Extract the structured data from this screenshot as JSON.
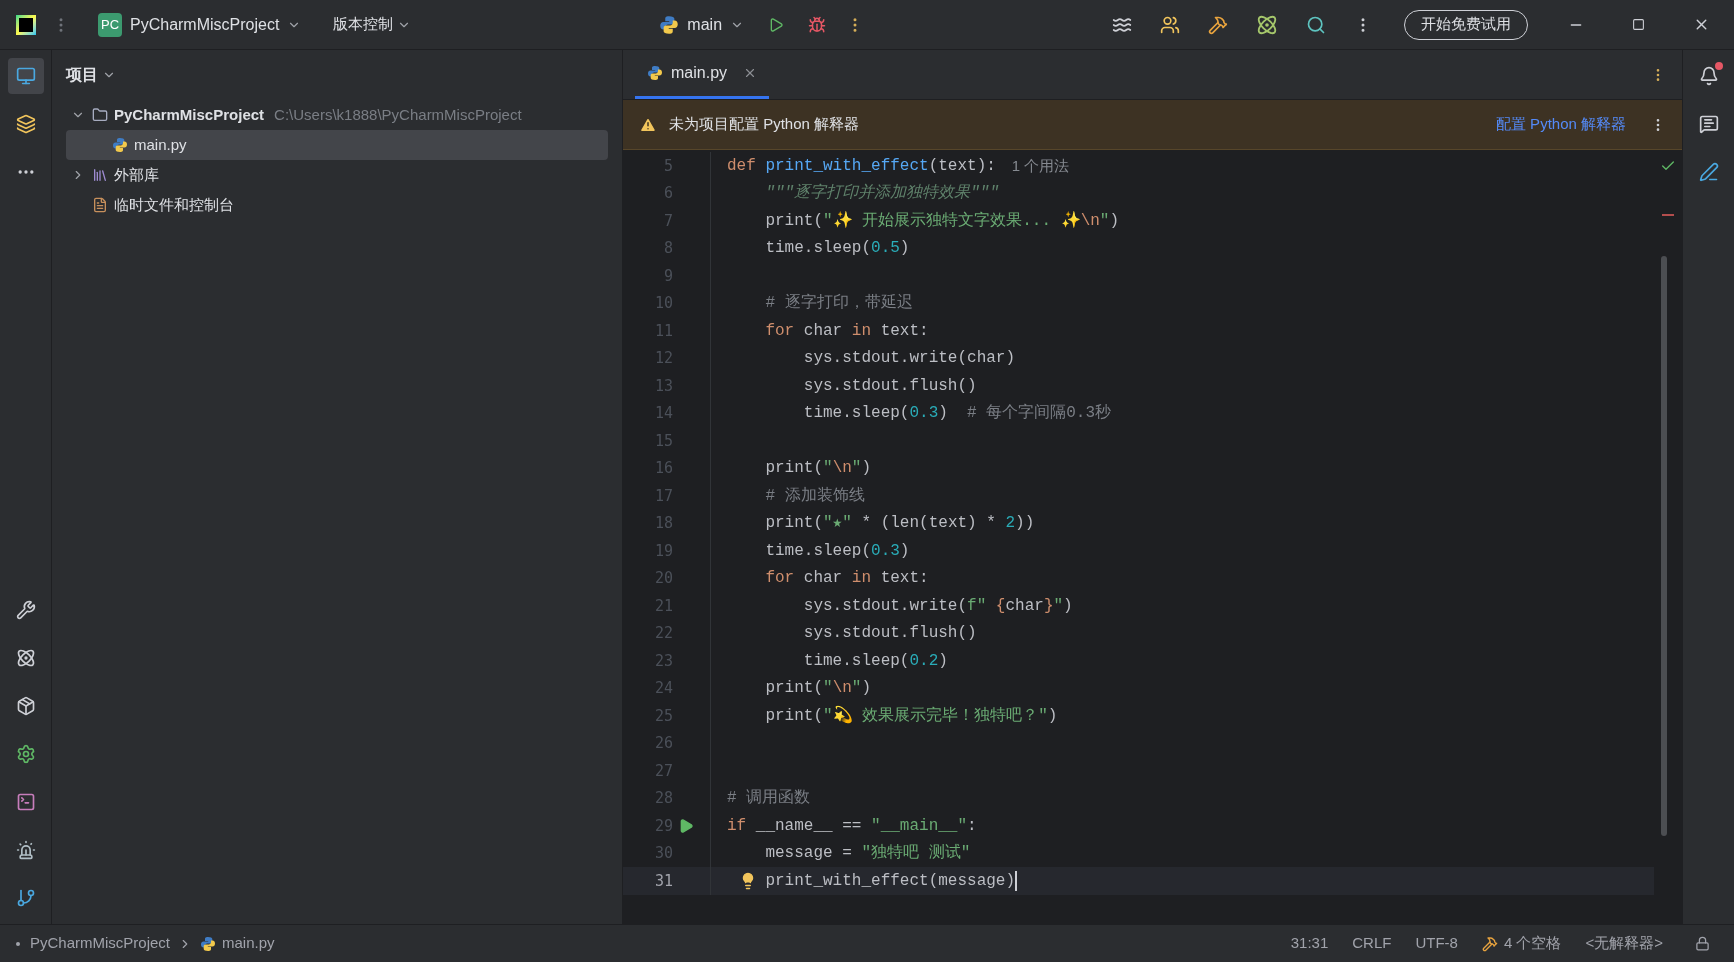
{
  "title_bar": {
    "project_badge": "PC",
    "project": "PyCharmMiscProject",
    "vcs": "版本控制",
    "run_config": "main",
    "trial_button": "开始免费试用"
  },
  "project_panel": {
    "title": "项目",
    "tree": [
      {
        "kind": "folder",
        "label": "PyCharmMiscProject",
        "path": "C:\\Users\\k1888\\PyCharmMiscProject",
        "expanded": true,
        "selected": false,
        "children": [
          {
            "kind": "python",
            "label": "main.py",
            "selected": true
          }
        ]
      },
      {
        "kind": "library",
        "label": "外部库",
        "expanded": false,
        "selected": false
      },
      {
        "kind": "scratch",
        "label": "临时文件和控制台",
        "selected": false
      }
    ]
  },
  "editor": {
    "tabs": [
      {
        "label": "main.py",
        "selected": true
      }
    ],
    "warning": {
      "text": "未为项目配置 Python 解释器",
      "action": "配置 Python 解释器"
    },
    "lines": [
      {
        "number": "5",
        "tokens": [
          {
            "kind": "kw",
            "text": "def "
          },
          {
            "kind": "fn",
            "text": "print_with_effect"
          },
          {
            "kind": "plain",
            "text": "(text):"
          },
          {
            "kind": "hint",
            "text": "1 个用法"
          }
        ]
      },
      {
        "number": "6",
        "tokens": [
          {
            "kind": "doc",
            "text": "    \"\"\"逐字打印并添加独特效果\"\"\""
          }
        ]
      },
      {
        "number": "7",
        "tokens": [
          {
            "kind": "plain",
            "text": "    print("
          },
          {
            "kind": "str",
            "text": "\"✨ 开始展示独特文字效果... ✨"
          },
          {
            "kind": "esc",
            "text": "\\n"
          },
          {
            "kind": "str",
            "text": "\""
          },
          {
            "kind": "plain",
            "text": ")"
          }
        ]
      },
      {
        "number": "8",
        "tokens": [
          {
            "kind": "plain",
            "text": "    time.sleep("
          },
          {
            "kind": "num",
            "text": "0.5"
          },
          {
            "kind": "plain",
            "text": ")"
          }
        ]
      },
      {
        "number": "9"
      },
      {
        "number": "10",
        "tokens": [
          {
            "kind": "cm",
            "text": "    # 逐字打印，带延迟"
          }
        ]
      },
      {
        "number": "11",
        "tokens": [
          {
            "kind": "kw",
            "text": "    for "
          },
          {
            "kind": "plain",
            "text": "char "
          },
          {
            "kind": "kw",
            "text": "in "
          },
          {
            "kind": "plain",
            "text": "text:"
          }
        ]
      },
      {
        "number": "12",
        "tokens": [
          {
            "kind": "plain",
            "text": "        sys.stdout.write(char)"
          }
        ]
      },
      {
        "number": "13",
        "tokens": [
          {
            "kind": "plain",
            "text": "        sys.stdout.flush()"
          }
        ]
      },
      {
        "number": "14",
        "tokens": [
          {
            "kind": "plain",
            "text": "        time.sleep("
          },
          {
            "kind": "num",
            "text": "0.3"
          },
          {
            "kind": "plain",
            "text": ")  "
          },
          {
            "kind": "cm",
            "text": "# 每个字间隔0.3秒"
          }
        ]
      },
      {
        "number": "15"
      },
      {
        "number": "16",
        "tokens": [
          {
            "kind": "plain",
            "text": "    print("
          },
          {
            "kind": "str",
            "text": "\""
          },
          {
            "kind": "esc",
            "text": "\\n"
          },
          {
            "kind": "str",
            "text": "\""
          },
          {
            "kind": "plain",
            "text": ")"
          }
        ]
      },
      {
        "number": "17",
        "tokens": [
          {
            "kind": "cm",
            "text": "    # 添加装饰线"
          }
        ]
      },
      {
        "number": "18",
        "tokens": [
          {
            "kind": "plain",
            "text": "    print("
          },
          {
            "kind": "str",
            "text": "\"★\""
          },
          {
            "kind": "plain",
            "text": " * (len(text) * "
          },
          {
            "kind": "num",
            "text": "2"
          },
          {
            "kind": "plain",
            "text": "))"
          }
        ]
      },
      {
        "number": "19",
        "tokens": [
          {
            "kind": "plain",
            "text": "    time.sleep("
          },
          {
            "kind": "num",
            "text": "0.3"
          },
          {
            "kind": "plain",
            "text": ")"
          }
        ]
      },
      {
        "number": "20",
        "tokens": [
          {
            "kind": "kw",
            "text": "    for "
          },
          {
            "kind": "plain",
            "text": "char "
          },
          {
            "kind": "kw",
            "text": "in "
          },
          {
            "kind": "plain",
            "text": "text:"
          }
        ]
      },
      {
        "number": "21",
        "tokens": [
          {
            "kind": "plain",
            "text": "        sys.stdout.write("
          },
          {
            "kind": "str",
            "text": "f\" "
          },
          {
            "kind": "kw",
            "text": "{"
          },
          {
            "kind": "plain",
            "text": "char"
          },
          {
            "kind": "kw",
            "text": "}"
          },
          {
            "kind": "str",
            "text": "\""
          },
          {
            "kind": "plain",
            "text": ")"
          }
        ]
      },
      {
        "number": "22",
        "tokens": [
          {
            "kind": "plain",
            "text": "        sys.stdout.flush()"
          }
        ]
      },
      {
        "number": "23",
        "tokens": [
          {
            "kind": "plain",
            "text": "        time.sleep("
          },
          {
            "kind": "num",
            "text": "0.2"
          },
          {
            "kind": "plain",
            "text": ")"
          }
        ]
      },
      {
        "number": "24",
        "tokens": [
          {
            "kind": "plain",
            "text": "    print("
          },
          {
            "kind": "str",
            "text": "\""
          },
          {
            "kind": "esc",
            "text": "\\n"
          },
          {
            "kind": "str",
            "text": "\""
          },
          {
            "kind": "plain",
            "text": ")"
          }
        ]
      },
      {
        "number": "25",
        "tokens": [
          {
            "kind": "plain",
            "text": "    print("
          },
          {
            "kind": "str",
            "text": "\"💫 效果展示完毕！独特吧？\""
          },
          {
            "kind": "plain",
            "text": ")"
          }
        ]
      },
      {
        "number": "26"
      },
      {
        "number": "27"
      },
      {
        "number": "28",
        "tokens": [
          {
            "kind": "cm",
            "text": "# 调用函数"
          }
        ]
      },
      {
        "number": "29",
        "run_marker": true,
        "tokens": [
          {
            "kind": "kw",
            "text": "if "
          },
          {
            "kind": "plain",
            "text": "__name__ == "
          },
          {
            "kind": "str",
            "text": "\"__main__\""
          },
          {
            "kind": "plain",
            "text": ":"
          }
        ]
      },
      {
        "number": "30",
        "tokens": [
          {
            "kind": "plain",
            "text": "    message = "
          },
          {
            "kind": "str",
            "text": "\"独特吧 测试\""
          }
        ]
      },
      {
        "number": "31",
        "intention_bulb": true,
        "current": true,
        "tokens": [
          {
            "kind": "plain",
            "text": "    print_with_effect(message)"
          }
        ]
      }
    ]
  },
  "status_bar": {
    "breadcrumbs": [
      {
        "kind": "project",
        "label": "PyCharmMiscProject"
      },
      {
        "kind": "python",
        "label": "main.py"
      }
    ],
    "position": "31:31",
    "line_ending": "CRLF",
    "encoding": "UTF-8",
    "indent": "4 个空格",
    "interpreter": "<无解释器>"
  }
}
